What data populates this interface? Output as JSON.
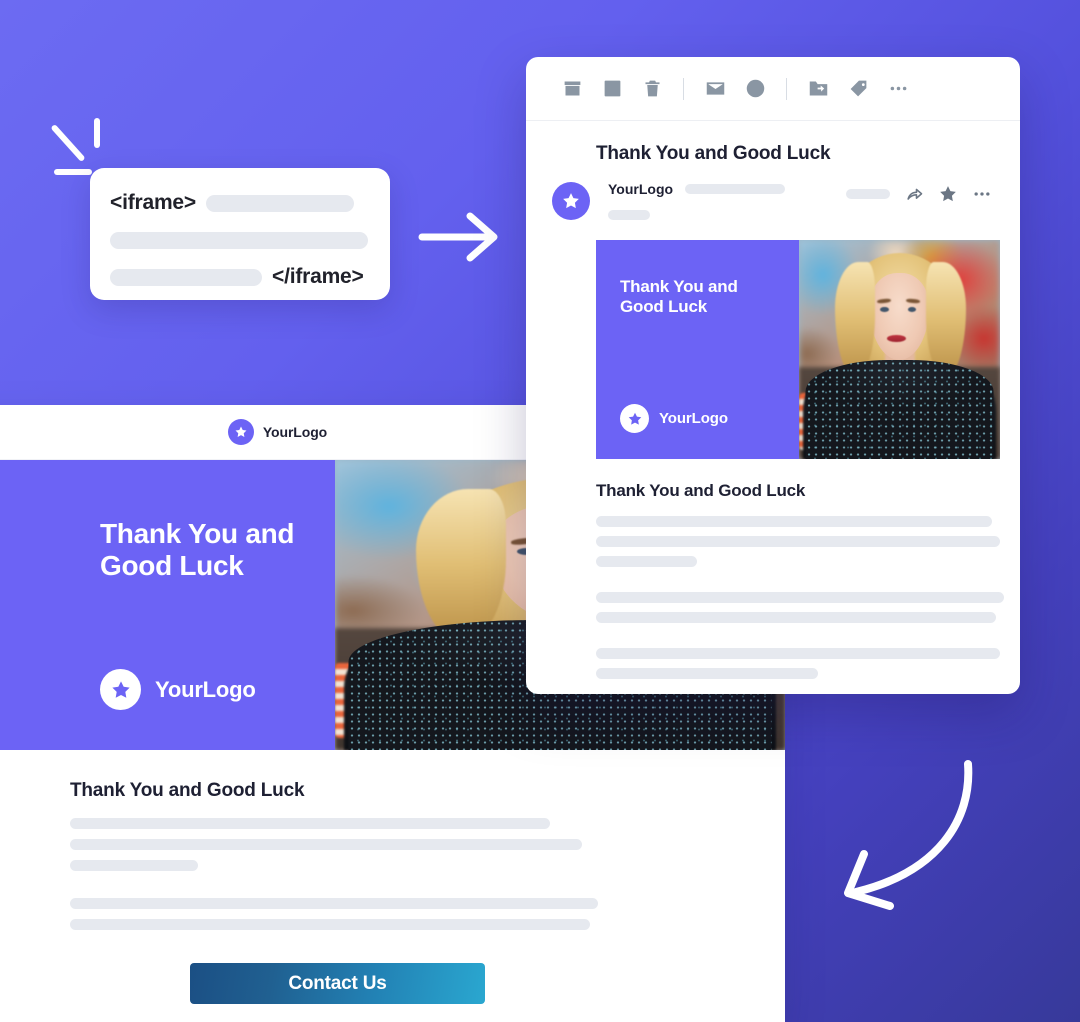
{
  "background": {
    "gradient_from": "#6C6BF2",
    "gradient_to": "#37399A"
  },
  "brand": {
    "accent_purple": "#6C63F5",
    "logo_name": "YourLogo",
    "logo_icon": "star-icon"
  },
  "decorations": {
    "sparkle_icon": "sparkle-icon",
    "straight_arrow_icon": "arrow-right-icon",
    "curved_arrow_icon": "curved-arrow-down-left-icon"
  },
  "code_card": {
    "open_tag": "<iframe>",
    "close_tag": "</iframe>",
    "placeholder_bars": [
      148,
      258,
      152
    ]
  },
  "mail_client": {
    "toolbar": [
      {
        "name": "archive-icon",
        "label": "Archive"
      },
      {
        "name": "report-spam-icon",
        "label": "Report spam"
      },
      {
        "name": "delete-icon",
        "label": "Delete"
      },
      {
        "name": "divider-1",
        "label": ""
      },
      {
        "name": "mark-unread-icon",
        "label": "Mark as unread"
      },
      {
        "name": "snooze-icon",
        "label": "Snooze"
      },
      {
        "name": "divider-2",
        "label": ""
      },
      {
        "name": "move-to-icon",
        "label": "Move to"
      },
      {
        "name": "label-icon",
        "label": "Labels"
      },
      {
        "name": "more-options-icon",
        "label": "More"
      }
    ],
    "subject": "Thank You and Good Luck",
    "sender": {
      "name": "YourLogo",
      "avatar_icon": "star-icon",
      "actions": [
        {
          "name": "reply-icon",
          "label": "Reply"
        },
        {
          "name": "star-icon",
          "label": "Star"
        },
        {
          "name": "more-options-icon",
          "label": "More"
        }
      ]
    },
    "hero": {
      "title": "Thank You and\nGood Luck",
      "logo_text": "YourLogo",
      "photo_alt": "Portrait of a smiling blonde woman in a black sequined top"
    },
    "body": {
      "title": "Thank You and Good Luck",
      "bar_groups": [
        [
          98,
          100,
          25
        ],
        [
          101,
          99
        ],
        [
          100,
          55
        ]
      ]
    }
  },
  "preview": {
    "header": {
      "logo_text": "YourLogo",
      "logo_icon": "star-icon"
    },
    "hero": {
      "title": "Thank You and\nGood Luck",
      "logo_text": "YourLogo",
      "photo_alt": "Portrait of a smiling blonde woman in a black sequined top"
    },
    "body": {
      "title": "Thank You and Good Luck",
      "bar_groups": [
        [
          480,
          512,
          128
        ],
        [
          528,
          520
        ]
      ],
      "cta_label": "Contact Us",
      "cta_gradient_from": "#1B4F84",
      "cta_gradient_to": "#2AA7D0"
    }
  }
}
